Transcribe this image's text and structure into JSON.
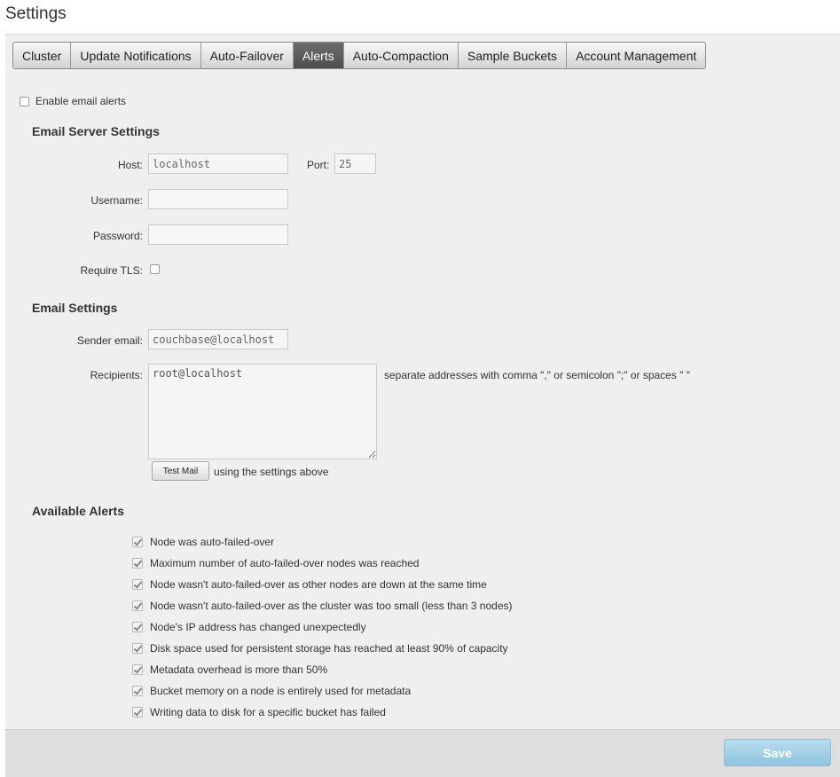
{
  "page": {
    "title": "Settings"
  },
  "tabs": [
    {
      "label": "Cluster"
    },
    {
      "label": "Update Notifications"
    },
    {
      "label": "Auto-Failover"
    },
    {
      "label": "Alerts"
    },
    {
      "label": "Auto-Compaction"
    },
    {
      "label": "Sample Buckets"
    },
    {
      "label": "Account Management"
    }
  ],
  "active_tab": "Alerts",
  "enable_alerts": {
    "label": "Enable email alerts",
    "checked": false
  },
  "email_server": {
    "heading": "Email Server Settings",
    "host_label": "Host:",
    "host_value": "localhost",
    "port_label": "Port:",
    "port_value": "25",
    "username_label": "Username:",
    "username_value": "",
    "password_label": "Password:",
    "password_value": "",
    "tls_label": "Require TLS:",
    "tls_checked": false
  },
  "email_settings": {
    "heading": "Email Settings",
    "sender_label": "Sender email:",
    "sender_value": "couchbase@localhost",
    "recipients_label": "Recipients:",
    "recipients_value": "root@localhost",
    "recipients_hint": "separate addresses with comma \",\" or semicolon \";\" or spaces \" \"",
    "test_button": "Test Mail",
    "test_hint": "using the settings above"
  },
  "alerts": {
    "heading": "Available Alerts",
    "items": [
      {
        "label": "Node was auto-failed-over",
        "checked": true
      },
      {
        "label": "Maximum number of auto-failed-over nodes was reached",
        "checked": true
      },
      {
        "label": "Node wasn't auto-failed-over as other nodes are down at the same time",
        "checked": true
      },
      {
        "label": "Node wasn't auto-failed-over as the cluster was too small (less than 3 nodes)",
        "checked": true
      },
      {
        "label": "Node's IP address has changed unexpectedly",
        "checked": true
      },
      {
        "label": "Disk space used for persistent storage has reached at least 90% of capacity",
        "checked": true
      },
      {
        "label": "Metadata overhead is more than 50%",
        "checked": true
      },
      {
        "label": "Bucket memory on a node is entirely used for metadata",
        "checked": true
      },
      {
        "label": "Writing data to disk for a specific bucket has failed",
        "checked": true
      }
    ]
  },
  "footer": {
    "save_label": "Save"
  },
  "colors": {
    "active_tab": "#5a5a5a",
    "save_button": "#a3d0e8",
    "panel_background": "#efefef"
  }
}
